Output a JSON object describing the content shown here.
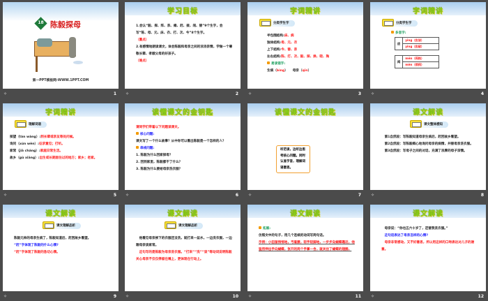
{
  "slides": [
    {
      "num": "1",
      "kind": "cover",
      "lesson_no": "18",
      "title": "陈毅探母",
      "footer_text": "第一PPT模板网-WWW.1PPT.COM"
    },
    {
      "num": "2",
      "kind": "text",
      "title": "学习目标",
      "lines": [
        {
          "t": "1.会认“毅、探、阵、亲、瘫、赶、拨、闯、替”9个生字，会写“陈、母、元、床、衣、打、次、今”8个生字。",
          "c": ""
        },
        {
          "t": "（重点）",
          "c": "red"
        },
        {
          "t": "2.有感情地朗读课文，体会陈毅和母亲之间的浓浓亲情，学做一个尊敬长辈、孝顺父母的好孩子。",
          "c": ""
        },
        {
          "t": "（难点）",
          "c": "red"
        }
      ]
    },
    {
      "num": "3",
      "kind": "text",
      "title": "字词精讲",
      "badge": "分类学生字",
      "lines": [
        {
          "t": "半包围结构:",
          "c": "",
          "r": "床、病"
        },
        {
          "t": "独体结构:",
          "c": "",
          "r": "母、元、衣"
        },
        {
          "t": "上下结构:",
          "c": "",
          "r": "今、替、亲"
        },
        {
          "t": "左右结构:",
          "c": "",
          "r": "陈、打、次、毅、探、换、晓、掏"
        },
        {
          "t": "易读错字:",
          "c": "green",
          "pin": true
        },
        {
          "t": "生病（",
          "c": "",
          "r": "bìng",
          "t2": "）　　母亲（",
          "r2": "qīn",
          "t3": "）"
        }
      ]
    },
    {
      "num": "4",
      "kind": "poly",
      "title": "字词精讲",
      "badge": "分类学生字",
      "sub": "多音字:",
      "groups": [
        {
          "ch": "应",
          "rows": [
            "yīng（应该）",
            "yìng（应敌）"
          ]
        },
        {
          "ch": "闷",
          "rows": [
            "mēn（闷热）",
            "mèn（烦闷）"
          ]
        }
      ]
    },
    {
      "num": "5",
      "kind": "text",
      "title": "字词精讲",
      "badge": "理解词语",
      "lines": [
        {
          "t": "探望（tàn wàng）:",
          "c": "",
          "r": "到长辈或亲友等处问候。"
        },
        {
          "t": "询问（xún wèn）:",
          "c": "",
          "r": "征求意见；打听。"
        },
        {
          "t": "家常（jiā cháng）:",
          "c": "",
          "r": "家庭日常生活。"
        },
        {
          "t": "故乡（gù xiāng）:",
          "c": "",
          "r": "出生或长期居住过的地方；家乡；老家。"
        }
      ]
    },
    {
      "num": "6",
      "kind": "text",
      "title": "读懂课文的金钥匙",
      "lines": [
        {
          "t": "请同学们带着以下问题读课文。",
          "c": "red"
        },
        {
          "t": "核心问题:",
          "c": "blue",
          "pin": true
        },
        {
          "t": "课文写了一个什么故事？从中你可以看出陈毅是一个怎样的人？",
          "c": ""
        },
        {
          "t": "串线问题:",
          "c": "blue",
          "pin": true
        },
        {
          "t": "1. 陈毅为什么回家探母？",
          "c": ""
        },
        {
          "t": "2. 回到家里，陈毅都干了什么？",
          "c": ""
        },
        {
          "t": "3. 陈毅为什么要给母亲洗衣服？",
          "c": ""
        }
      ]
    },
    {
      "num": "7",
      "kind": "box",
      "title": "读懂课文的金钥匙",
      "box": "听范读，边听边思考核心问题。同时认准字音，理解词语意思。"
    },
    {
      "num": "8",
      "kind": "text",
      "title": "课文解读",
      "badge": "课文整体感知",
      "lines": [
        {
          "t": "　第1自然段：写陈毅知道母亲生病后，赶回故乡看望。",
          "c": ""
        },
        {
          "t": "　第2自然段：写陈毅细心地询问母亲的病情，并替母亲洗衣服。",
          "c": ""
        },
        {
          "t": "　第3自然段：写母子之间的对话，充满了浓厚的母子深情。",
          "c": ""
        }
      ]
    },
    {
      "num": "9",
      "kind": "text",
      "title": "课文解读",
      "badge": "课文理解品析",
      "lines": [
        {
          "t": "陈毅元帅的母亲生病了，陈毅知道后，赶回故乡看望。",
          "c": ""
        },
        {
          "t": "“赶”字体现了陈毅的什么心情?",
          "c": "blue"
        },
        {
          "t": "“赶”字体现了陈毅的急切心情。",
          "c": "red"
        }
      ]
    },
    {
      "num": "10",
      "kind": "text",
      "title": "课文解读",
      "badge": "课文理解品析",
      "lines": [
        {
          "t": "　他看见母亲换下的衣服还没洗，就打来一盆水，一边洗衣服，一边跟母亲谈家常。",
          "c": ""
        },
        {
          "t": "　这句写的是陈毅为母亲洗衣服。“打来”“洗”“谈”等动词说明陈毅关心母亲不仅仅停留在嘴上，更体现在行动上。",
          "c": "red"
        }
      ]
    },
    {
      "num": "11",
      "kind": "text",
      "title": "课文解读",
      "lines": [
        {
          "t": "拓展:",
          "c": "green",
          "pin": true
        },
        {
          "t": "仿照文中的句子，用几个连续的动词写两句话。",
          "c": ""
        },
        {
          "t": "示例：小田鼠悄悄地，弓着腰，轻手轻脚地，一步步向蝴蝶靠近，他猛然伸出手向蝴蝶，张开的两个手掌一合，就关住了蝴蝶的翅膀。",
          "c": "red",
          "u": true
        }
      ]
    },
    {
      "num": "12",
      "kind": "text",
      "title": "课文解读",
      "lines": [
        {
          "t": "　母亲说：“你也五六十岁了，还替我洗衣服。”",
          "c": ""
        },
        {
          "t": "　这句话表达了母亲怎样的心情?",
          "c": "blue"
        },
        {
          "t": "　母亲非常感动，又不好意思，所以用这样的口吻表达对儿子的谢意。",
          "c": "red"
        }
      ]
    }
  ],
  "footer_icon": "slide-transition-icon"
}
